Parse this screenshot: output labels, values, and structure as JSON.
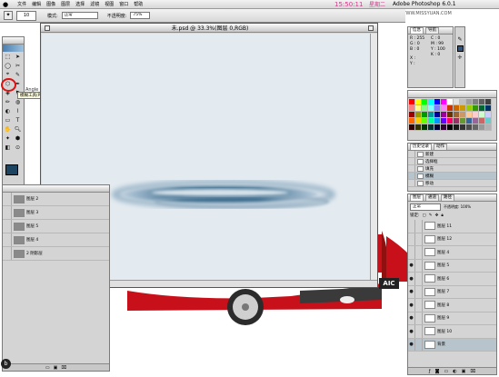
{
  "menu_bar": {
    "items": [
      "文件",
      "编辑",
      "图像",
      "图层",
      "选择",
      "滤镜",
      "视图",
      "窗口",
      "帮助"
    ],
    "clock": "15:50:11",
    "extra": "星期二",
    "app_name": "Adobe Photoshop 6.0.1",
    "watermark": "思缘设计论坛 WWW.MISSYUAN.COM"
  },
  "options_bar": {
    "mode_label": "模式:",
    "mode_value": "正常",
    "opacity_label": "不透明度:",
    "opacity_value": "75%",
    "brush_size": "10"
  },
  "toolbox": {
    "tooltip": "模糊工具(R)",
    "partial_label": "Angle"
  },
  "document": {
    "title": "未.psd @ 33.3%(图层 0,RGB)",
    "zoom": "33.33%"
  },
  "car_badge": "AIC",
  "info_panel": {
    "tabs": [
      "信息",
      "导航"
    ],
    "r_label": "R :",
    "r_value": "255",
    "g_label": "G :",
    "g_value": "0",
    "b_label": "B :",
    "b_value": "0",
    "c_label": "C :",
    "c_value": "0",
    "m_label": "M :",
    "m_value": "99",
    "y_label": "Y :",
    "y_value": "100",
    "k_label": "K :",
    "k_value": "0",
    "x_label": "X :",
    "y2_label": "Y :"
  },
  "history_panel": {
    "tabs": [
      "历史记录",
      "动作"
    ],
    "items": [
      "新建",
      "选择框",
      "填充",
      "模糊",
      "移动"
    ]
  },
  "layers_panel": {
    "tabs": [
      "图层",
      "通道",
      "路径"
    ],
    "blend": "正常",
    "opacity": "不透明度: 100%",
    "lock_label": "锁定:",
    "layers": [
      {
        "name": "图层 11"
      },
      {
        "name": "图层 12"
      },
      {
        "name": "图层 4"
      },
      {
        "name": "图层 5"
      },
      {
        "name": "图层 6"
      },
      {
        "name": "图层 7"
      },
      {
        "name": "图层 8"
      },
      {
        "name": "图层 9"
      },
      {
        "name": "图层 10"
      },
      {
        "name": "背景"
      }
    ]
  },
  "secondary_layers": {
    "items": [
      "图层 2",
      "图层 3",
      "图层 5",
      "图层 4",
      "2 阴影层"
    ]
  },
  "colors": {
    "canvas_bg": "#e4ebf0",
    "foreground": "#1d4460",
    "car_red": "#c8101a",
    "swatches": [
      "#ff0000",
      "#ffff00",
      "#00ff00",
      "#00ffff",
      "#0000ff",
      "#ff00ff",
      "#ffffff",
      "#e0e0e0",
      "#c0c0c0",
      "#a0a0a0",
      "#808080",
      "#606060",
      "#404040",
      "#ff8080",
      "#ffff80",
      "#80ff80",
      "#80ffff",
      "#8080ff",
      "#ff80ff",
      "#cc3300",
      "#cc6600",
      "#cc9900",
      "#99cc00",
      "#339900",
      "#006633",
      "#003366",
      "#990000",
      "#999900",
      "#009900",
      "#009999",
      "#000099",
      "#990099",
      "#663300",
      "#996633",
      "#cc9966",
      "#ffcc99",
      "#ffcccc",
      "#ccffcc",
      "#ccccff",
      "#ff6600",
      "#ffcc00",
      "#66ff00",
      "#00ff99",
      "#0099ff",
      "#6600ff",
      "#ff0066",
      "#993366",
      "#669933",
      "#336699",
      "#996699",
      "#cc6666",
      "#66cccc",
      "#330000",
      "#333300",
      "#003300",
      "#003333",
      "#000033",
      "#330033",
      "#000000",
      "#1a1a1a",
      "#333333",
      "#4d4d4d",
      "#666666",
      "#999999",
      "#b3b3b3"
    ]
  }
}
